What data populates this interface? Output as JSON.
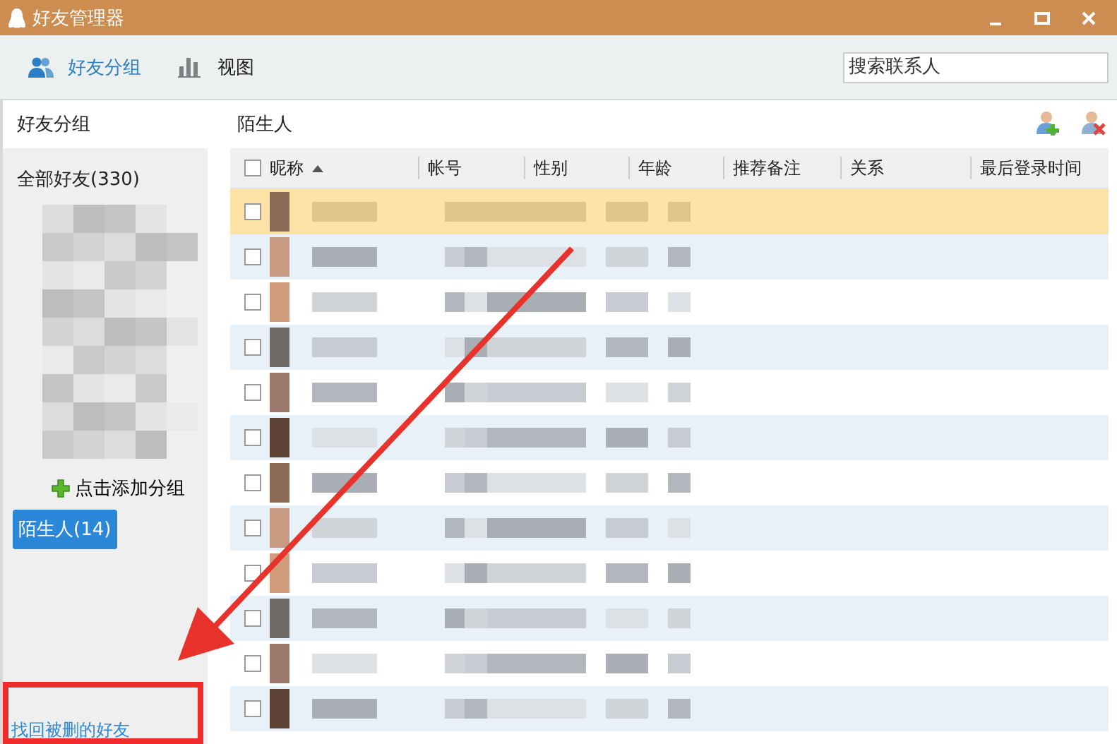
{
  "window": {
    "title": "好友管理器"
  },
  "toolbar": {
    "tabs": [
      {
        "label": "好友分组",
        "selected": true
      },
      {
        "label": "视图",
        "selected": false
      }
    ],
    "search": {
      "placeholder": "搜索联系人"
    }
  },
  "sidebar": {
    "heading": "好友分组",
    "items": [
      {
        "kind": "group",
        "label": "全部好友(330)",
        "selected": false
      },
      {
        "kind": "blurred"
      },
      {
        "kind": "add",
        "label": "点击添加分组"
      },
      {
        "kind": "group",
        "label": "陌生人(14)",
        "selected": true
      }
    ],
    "footer_link": "找回被删的好友"
  },
  "main": {
    "heading": "陌生人",
    "table": {
      "select_all": {
        "checked": false
      },
      "columns": [
        {
          "label": "昵称",
          "sorted": true
        },
        {
          "label": "帐号",
          "sorted": false
        },
        {
          "label": "性别",
          "sorted": false
        },
        {
          "label": "年龄",
          "sorted": false
        },
        {
          "label": "推荐备注",
          "sorted": false
        },
        {
          "label": "关系",
          "sorted": false
        },
        {
          "label": "最后登录时间",
          "sorted": false
        }
      ],
      "rows": [
        {
          "selected": true,
          "checked": false
        },
        {
          "selected": false,
          "checked": false
        },
        {
          "selected": false,
          "checked": false
        },
        {
          "selected": false,
          "checked": false
        },
        {
          "selected": false,
          "checked": false
        },
        {
          "selected": false,
          "checked": false
        },
        {
          "selected": false,
          "checked": false
        },
        {
          "selected": false,
          "checked": false
        },
        {
          "selected": false,
          "checked": false
        },
        {
          "selected": false,
          "checked": false
        },
        {
          "selected": false,
          "checked": false
        },
        {
          "selected": false,
          "checked": false
        }
      ]
    }
  }
}
